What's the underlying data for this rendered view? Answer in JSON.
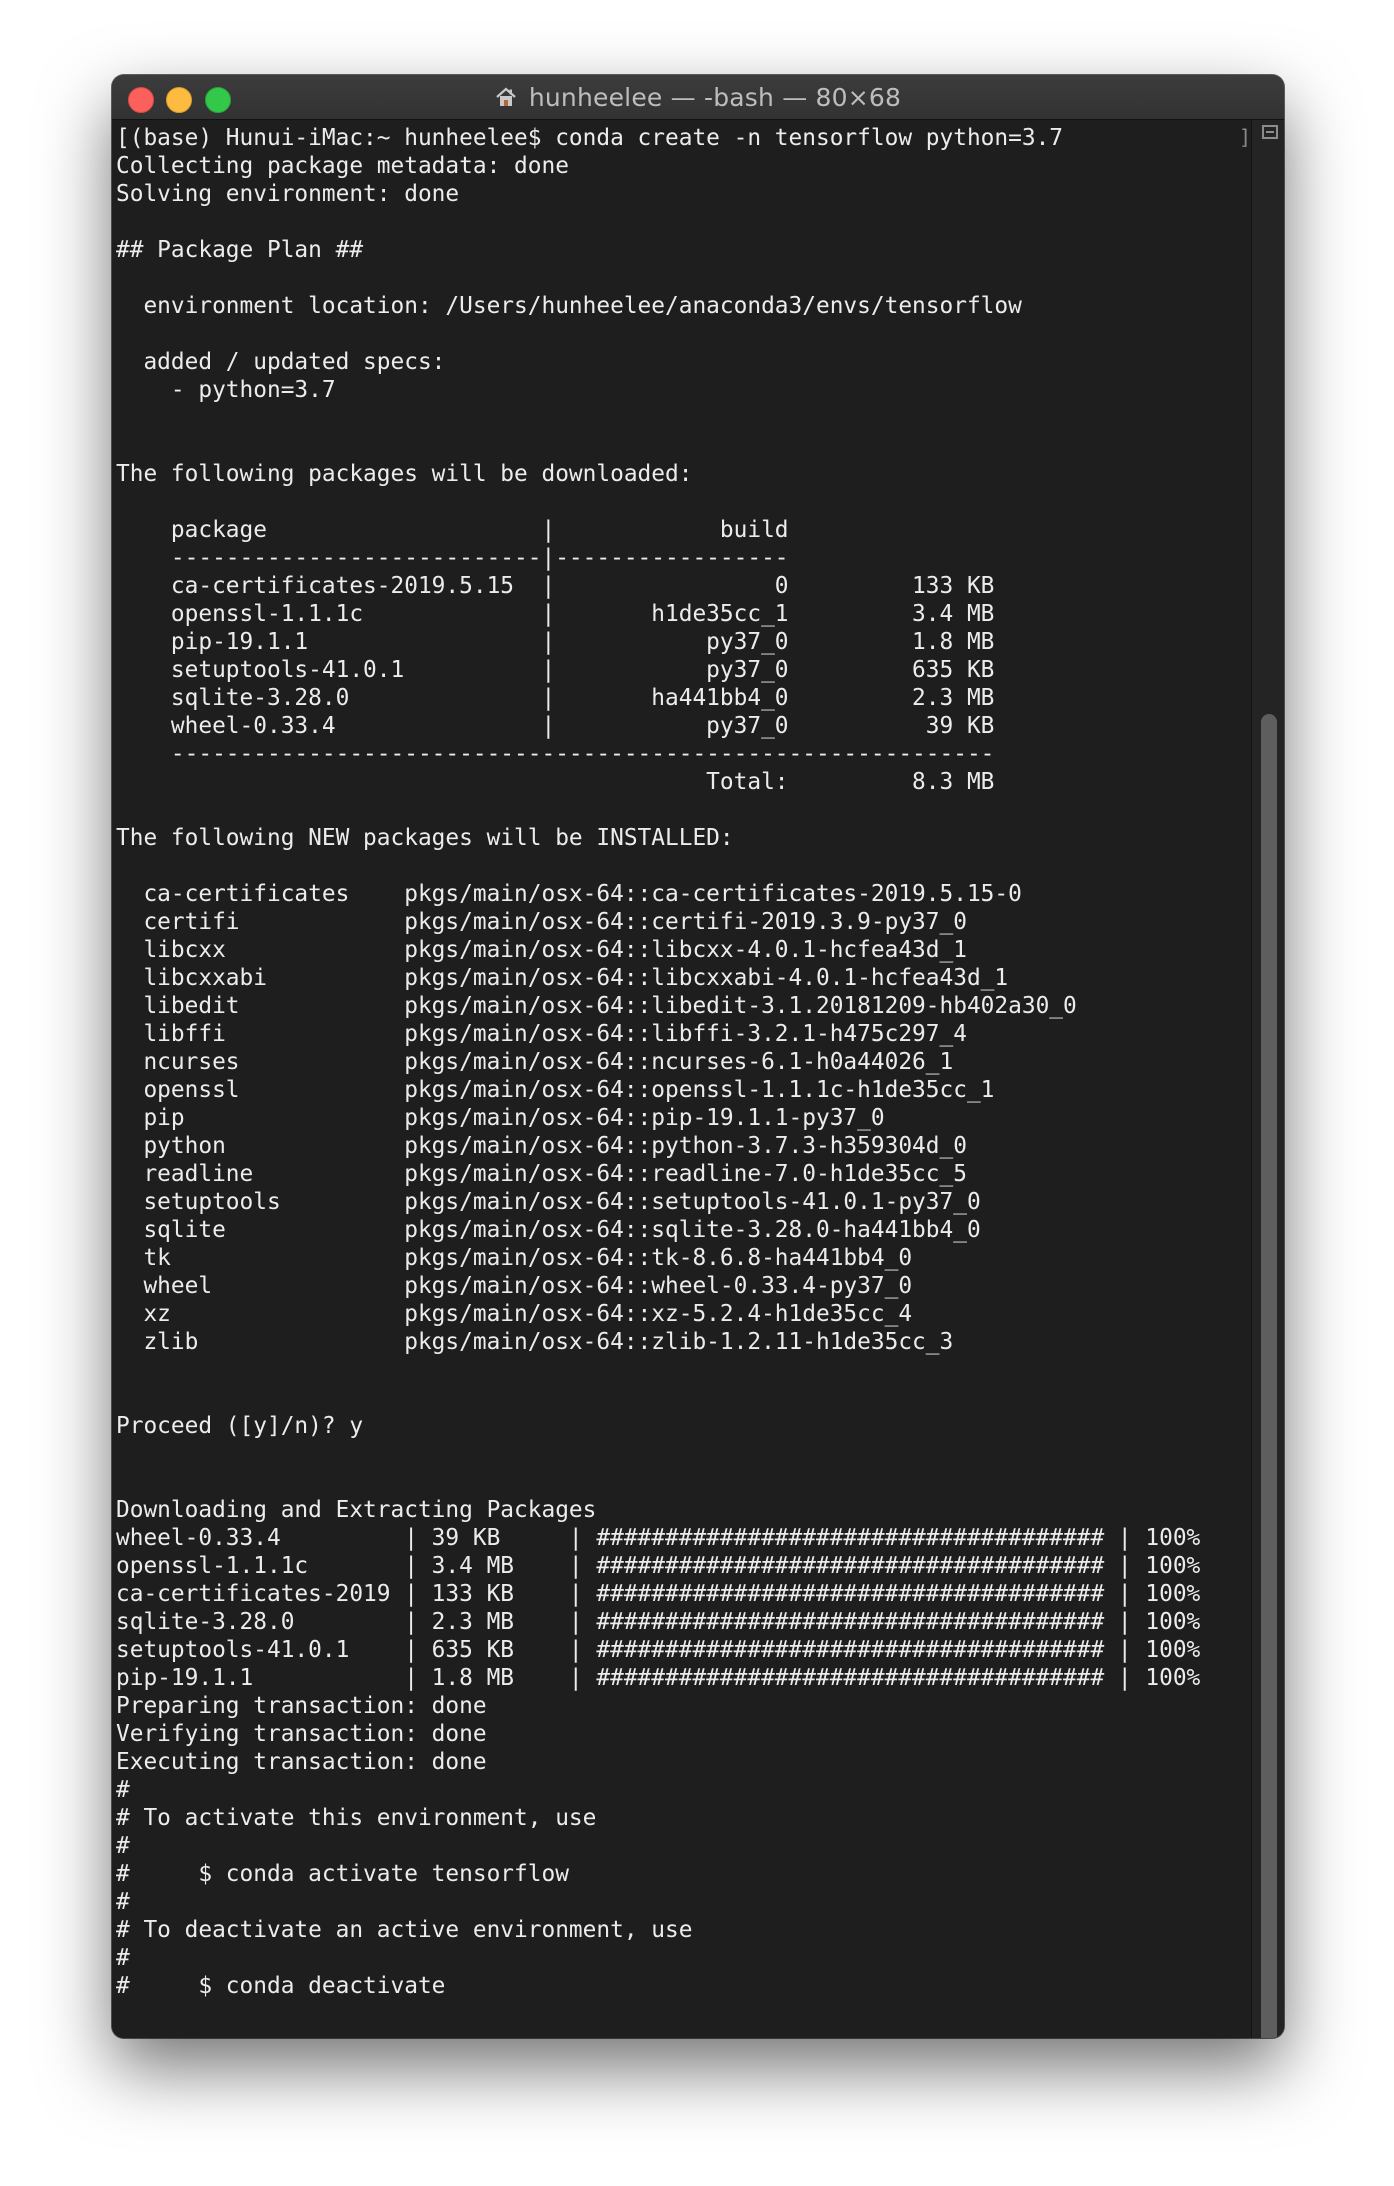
{
  "window": {
    "title": "hunheelee — -bash — 80×68",
    "home_icon": "house-icon",
    "bracket": "]"
  },
  "terminal": {
    "lines": [
      "[(base) Hunui-iMac:~ hunheelee$ conda create -n tensorflow python=3.7",
      "Collecting package metadata: done",
      "Solving environment: done",
      "",
      "## Package Plan ##",
      "",
      "  environment location: /Users/hunheelee/anaconda3/envs/tensorflow",
      "",
      "  added / updated specs:",
      "    - python=3.7",
      "",
      "",
      "The following packages will be downloaded:",
      "",
      "    package                    |            build",
      "    ---------------------------|-----------------",
      "    ca-certificates-2019.5.15  |                0         133 KB",
      "    openssl-1.1.1c             |       h1de35cc_1         3.4 MB",
      "    pip-19.1.1                 |           py37_0         1.8 MB",
      "    setuptools-41.0.1          |           py37_0         635 KB",
      "    sqlite-3.28.0              |       ha441bb4_0         2.3 MB",
      "    wheel-0.33.4               |           py37_0          39 KB",
      "    ------------------------------------------------------------",
      "                                           Total:         8.3 MB",
      "",
      "The following NEW packages will be INSTALLED:",
      "",
      "  ca-certificates    pkgs/main/osx-64::ca-certificates-2019.5.15-0",
      "  certifi            pkgs/main/osx-64::certifi-2019.3.9-py37_0",
      "  libcxx             pkgs/main/osx-64::libcxx-4.0.1-hcfea43d_1",
      "  libcxxabi          pkgs/main/osx-64::libcxxabi-4.0.1-hcfea43d_1",
      "  libedit            pkgs/main/osx-64::libedit-3.1.20181209-hb402a30_0",
      "  libffi             pkgs/main/osx-64::libffi-3.2.1-h475c297_4",
      "  ncurses            pkgs/main/osx-64::ncurses-6.1-h0a44026_1",
      "  openssl            pkgs/main/osx-64::openssl-1.1.1c-h1de35cc_1",
      "  pip                pkgs/main/osx-64::pip-19.1.1-py37_0",
      "  python             pkgs/main/osx-64::python-3.7.3-h359304d_0",
      "  readline           pkgs/main/osx-64::readline-7.0-h1de35cc_5",
      "  setuptools         pkgs/main/osx-64::setuptools-41.0.1-py37_0",
      "  sqlite             pkgs/main/osx-64::sqlite-3.28.0-ha441bb4_0",
      "  tk                 pkgs/main/osx-64::tk-8.6.8-ha441bb4_0",
      "  wheel              pkgs/main/osx-64::wheel-0.33.4-py37_0",
      "  xz                 pkgs/main/osx-64::xz-5.2.4-h1de35cc_4",
      "  zlib               pkgs/main/osx-64::zlib-1.2.11-h1de35cc_3",
      "",
      "",
      "Proceed ([y]/n)? y",
      "",
      "",
      "Downloading and Extracting Packages",
      "wheel-0.33.4         | 39 KB     | ##################################### | 100%",
      "openssl-1.1.1c       | 3.4 MB    | ##################################### | 100%",
      "ca-certificates-2019 | 133 KB    | ##################################### | 100%",
      "sqlite-3.28.0        | 2.3 MB    | ##################################### | 100%",
      "setuptools-41.0.1    | 635 KB    | ##################################### | 100%",
      "pip-19.1.1           | 1.8 MB    | ##################################### | 100%",
      "Preparing transaction: done",
      "Verifying transaction: done",
      "Executing transaction: done",
      "#",
      "# To activate this environment, use",
      "#",
      "#     $ conda activate tensorflow",
      "#",
      "# To deactivate an active environment, use",
      "#",
      "#     $ conda deactivate"
    ]
  },
  "colors": {
    "background": "#1e1e1e",
    "text": "#ececec",
    "close": "#fc605c",
    "minimize": "#fdbc40",
    "maximize": "#34c84a"
  }
}
